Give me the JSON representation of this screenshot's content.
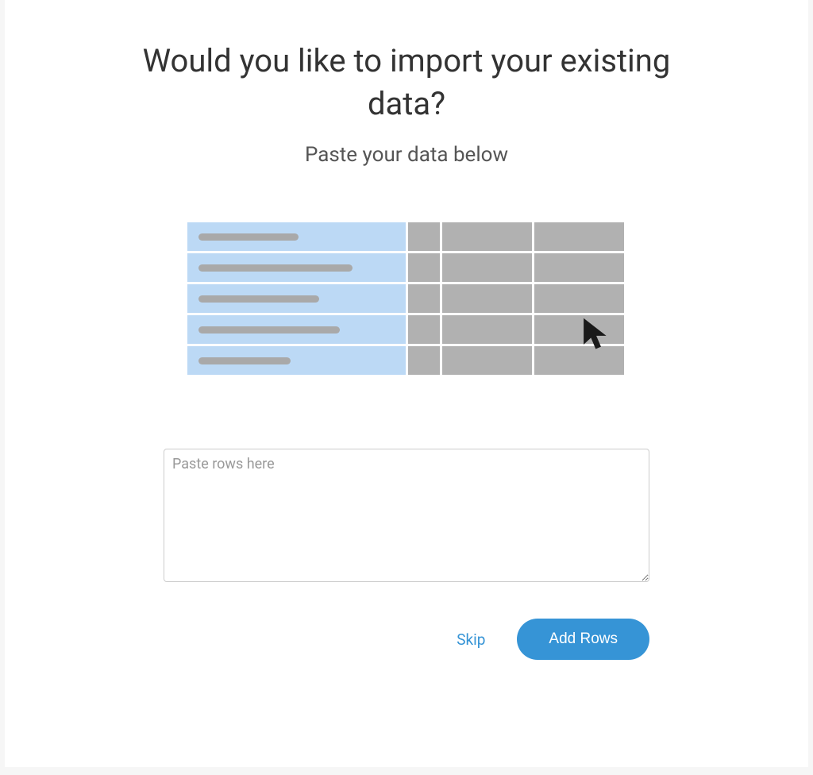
{
  "header": {
    "title": "Would you like to import your existing data?",
    "subtitle": "Paste your data below"
  },
  "textarea": {
    "placeholder": "Paste rows here",
    "value": ""
  },
  "actions": {
    "skip_label": "Skip",
    "add_rows_label": "Add Rows"
  },
  "icons": {
    "cursor": "cursor-icon"
  },
  "colors": {
    "accent": "#3694d6",
    "illustration_label_bg": "#bcd9f5",
    "illustration_cell_bg": "#b1b1b1"
  }
}
